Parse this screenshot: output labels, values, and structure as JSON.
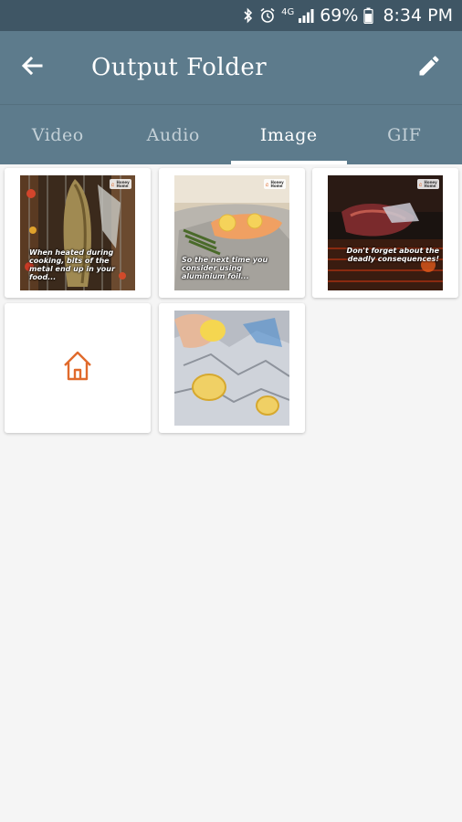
{
  "status_bar": {
    "network_type": "4G",
    "battery_percent": "69%",
    "time": "8:34 PM"
  },
  "app_bar": {
    "title": "Output Folder",
    "back_icon": "arrow-left-icon",
    "edit_icon": "pencil-icon"
  },
  "tabs": [
    {
      "label": "Video",
      "active": false
    },
    {
      "label": "Audio",
      "active": false
    },
    {
      "label": "Image",
      "active": true
    },
    {
      "label": "GIF",
      "active": false
    }
  ],
  "images": [
    {
      "caption": "When heated during cooking, bits of the metal end up in your food...",
      "brand": "Honey Home"
    },
    {
      "caption": "So the next time you consider using aluminium foil...",
      "brand": "Honey Home"
    },
    {
      "caption": "Don't forget about the deadly consequences!",
      "brand": "Honey Home"
    },
    {
      "caption": "",
      "icon": "home-icon"
    },
    {
      "caption": "",
      "brand": ""
    }
  ],
  "colors": {
    "status_bar": "#3f5665",
    "app_bar": "#5d7b8c",
    "accent_home_icon": "#e06a2c",
    "background": "#f5f5f5"
  }
}
